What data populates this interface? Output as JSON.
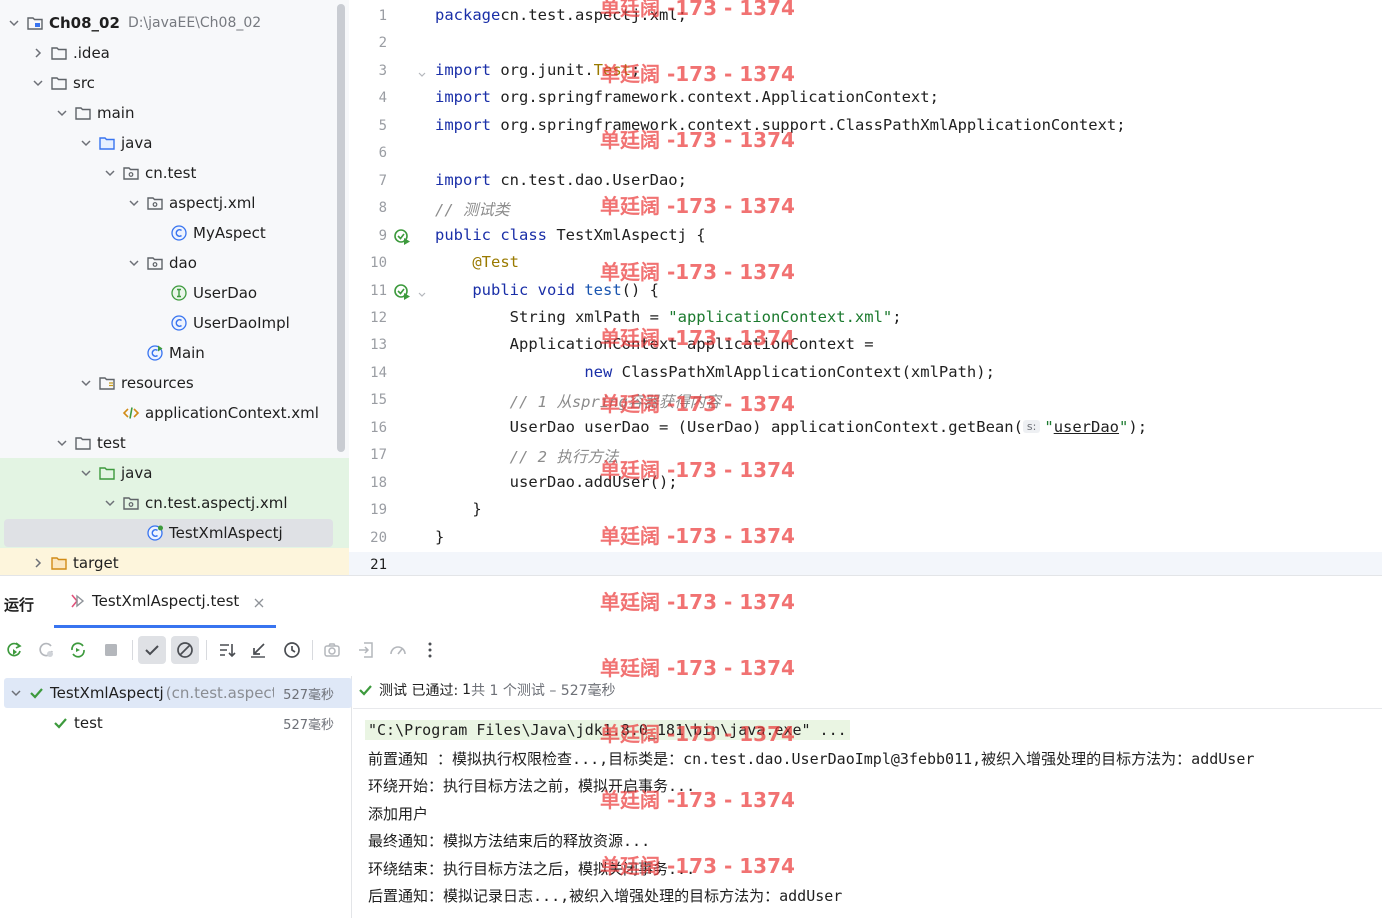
{
  "project_tree": {
    "items": [
      {
        "label": "Ch08_02",
        "path": "D:\\javaEE\\Ch08_02",
        "level": 0,
        "arrow": "down",
        "icon": "module-folder"
      },
      {
        "label": ".idea",
        "level": 1,
        "arrow": "right",
        "icon": "folder"
      },
      {
        "label": "src",
        "level": 1,
        "arrow": "down",
        "icon": "folder"
      },
      {
        "label": "main",
        "level": 2,
        "arrow": "down",
        "icon": "folder"
      },
      {
        "label": "java",
        "level": 3,
        "arrow": "down",
        "icon": "source-folder"
      },
      {
        "label": "cn.test",
        "level": 4,
        "arrow": "down",
        "icon": "package"
      },
      {
        "label": "aspectj.xml",
        "level": 5,
        "arrow": "down",
        "icon": "package"
      },
      {
        "label": "MyAspect",
        "level": 6,
        "arrow": "none",
        "icon": "class"
      },
      {
        "label": "dao",
        "level": 5,
        "arrow": "down",
        "icon": "package"
      },
      {
        "label": "UserDao",
        "level": 6,
        "arrow": "none",
        "icon": "interface"
      },
      {
        "label": "UserDaoImpl",
        "level": 6,
        "arrow": "none",
        "icon": "class"
      },
      {
        "label": "Main",
        "level": 5,
        "arrow": "none",
        "icon": "main-class"
      },
      {
        "label": "resources",
        "level": 3,
        "arrow": "down",
        "icon": "resources-folder"
      },
      {
        "label": "applicationContext.xml",
        "level": 4,
        "arrow": "none",
        "icon": "xml-file"
      },
      {
        "label": "test",
        "level": 2,
        "arrow": "down",
        "icon": "folder"
      },
      {
        "label": "java",
        "level": 3,
        "arrow": "down",
        "icon": "test-folder"
      },
      {
        "label": "cn.test.aspectj.xml",
        "level": 4,
        "arrow": "down",
        "icon": "package"
      },
      {
        "label": "TestXmlAspectj",
        "level": 5,
        "arrow": "none",
        "icon": "test-class"
      },
      {
        "label": "target",
        "level": 1,
        "arrow": "right",
        "icon": "excluded-folder"
      }
    ]
  },
  "editor": {
    "lines": [
      {
        "n": "1",
        "tokens": [
          [
            "kw",
            "package"
          ],
          [
            "",
            "cn.test.aspectj.xml;"
          ]
        ]
      },
      {
        "n": "2",
        "tokens": []
      },
      {
        "n": "3",
        "tokens": [
          [
            "kw",
            "import"
          ],
          [
            "",
            " org.junit."
          ],
          [
            "ann",
            "Test"
          ],
          [
            "",
            ";"
          ]
        ]
      },
      {
        "n": "4",
        "tokens": [
          [
            "kw",
            "import"
          ],
          [
            "",
            " org.springframework.context.ApplicationContext;"
          ]
        ]
      },
      {
        "n": "5",
        "tokens": [
          [
            "kw",
            "import"
          ],
          [
            "",
            " org.springframework.context.support.ClassPathXmlApplicationContext;"
          ]
        ]
      },
      {
        "n": "6",
        "tokens": []
      },
      {
        "n": "7",
        "tokens": [
          [
            "kw",
            "import"
          ],
          [
            "",
            " cn.test.dao.UserDao;"
          ]
        ]
      },
      {
        "n": "8",
        "tokens": [
          [
            "cmt",
            "// 测试类"
          ]
        ]
      },
      {
        "n": "9",
        "tokens": [
          [
            "kw",
            "public class"
          ],
          [
            "",
            " TestXmlAspectj {"
          ]
        ]
      },
      {
        "n": "10",
        "tokens": [
          [
            "",
            "    "
          ],
          [
            "ann",
            "@Test"
          ]
        ]
      },
      {
        "n": "11",
        "tokens": [
          [
            "",
            "    "
          ],
          [
            "kw",
            "public void"
          ],
          [
            "",
            " "
          ],
          [
            "meth",
            "test"
          ],
          [
            "",
            "() {"
          ]
        ]
      },
      {
        "n": "12",
        "tokens": [
          [
            "",
            "        String xmlPath = "
          ],
          [
            "str",
            "\"applicationContext.xml\""
          ],
          [
            "",
            ";"
          ]
        ]
      },
      {
        "n": "13",
        "tokens": [
          [
            "",
            "        ApplicationContext applicationContext ="
          ]
        ]
      },
      {
        "n": "14",
        "tokens": [
          [
            "",
            "                "
          ],
          [
            "kw",
            "new"
          ],
          [
            "",
            " ClassPathXmlApplicationContext(xmlPath);"
          ]
        ]
      },
      {
        "n": "15",
        "tokens": [
          [
            "",
            "        "
          ],
          [
            "cmt",
            "// 1 从spring容器获得内容"
          ]
        ]
      },
      {
        "n": "16",
        "tokens": [
          [
            "",
            "        UserDao userDao = (UserDao) applicationContext.getBean("
          ],
          [
            "hint",
            "s:"
          ],
          [
            "str",
            "\""
          ],
          [
            "strul",
            "userDao"
          ],
          [
            "str",
            "\""
          ],
          [
            "",
            ");"
          ]
        ]
      },
      {
        "n": "17",
        "tokens": [
          [
            "",
            "        "
          ],
          [
            "cmt",
            "// 2 执行方法"
          ]
        ]
      },
      {
        "n": "18",
        "tokens": [
          [
            "",
            "        userDao.addUser();"
          ]
        ]
      },
      {
        "n": "19",
        "tokens": [
          [
            "",
            "    }"
          ]
        ]
      },
      {
        "n": "20",
        "tokens": [
          [
            "",
            "}"
          ]
        ]
      },
      {
        "n": "21",
        "tokens": []
      }
    ]
  },
  "run_panel": {
    "title": "运行",
    "tab_label": "TestXmlAspectj.test",
    "test_tree": [
      {
        "label": "TestXmlAspectj",
        "pkg": "(cn.test.aspectj.xml)",
        "time": "527毫秒"
      },
      {
        "label": "test",
        "time": "527毫秒"
      }
    ],
    "status": {
      "prefix": "测试 已通过:",
      "count": "1",
      "detail": "共 1 个测试 – 527毫秒"
    },
    "console": [
      "\"C:\\Program Files\\Java\\jdk1.8.0_181\\bin\\java.exe\" ...",
      "前置通知 ：模拟执行权限检查...,目标类是：cn.test.dao.UserDaoImpl@3febb011,被织入增强处理的目标方法为：addUser",
      "环绕开始：执行目标方法之前，模拟开启事务...",
      "添加用户",
      "最终通知：模拟方法结束后的释放资源...",
      "环绕结束：执行目标方法之后，模拟关闭事务...",
      "后置通知：模拟记录日志...,被织入增强处理的目标方法为：addUser"
    ]
  },
  "watermark": "单廷阔 -173 - 1374",
  "colors": {
    "accent": "#3874f0",
    "pass_green": "#3d9a3d",
    "keyword": "#1a2fa8",
    "string": "#1b7a2e",
    "watermark": "#eb3c3c"
  }
}
